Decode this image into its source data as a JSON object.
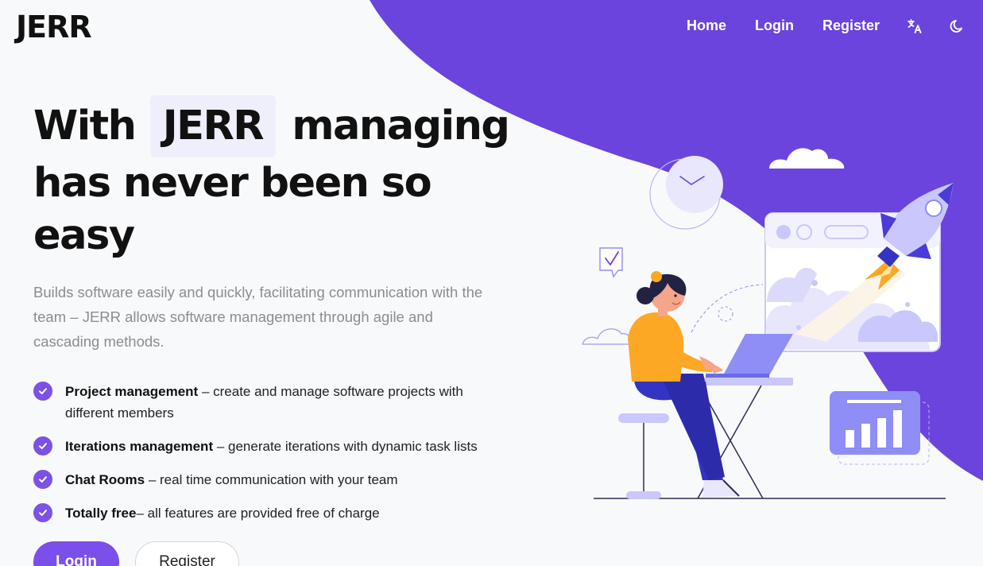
{
  "header": {
    "logo": "JERR",
    "nav": {
      "home": "Home",
      "login": "Login",
      "register": "Register"
    },
    "icons": [
      "translate-icon",
      "moon-icon"
    ]
  },
  "hero": {
    "headline_before": "With",
    "headline_highlight": "JERR",
    "headline_after": "managing",
    "headline_line2": "has never been so easy",
    "subtitle": "Builds software easily and quickly, facilitating communication with the team – JERR allows software management through agile and cascading methods."
  },
  "features": [
    {
      "title": "Project management",
      "text": " – create and manage software projects with different members"
    },
    {
      "title": "Iterations management",
      "text": " – generate iterations with dynamic task lists"
    },
    {
      "title": "Chat Rooms",
      "text": " – real time communication with your team"
    },
    {
      "title": "Totally free",
      "text": "– all features are provided free of charge"
    }
  ],
  "actions": {
    "login": "Login",
    "register": "Register"
  },
  "colors": {
    "accent": "#6b44dd",
    "button": "#7b4fe9",
    "check": "#7b51e6",
    "background": "#f8f9fa",
    "illustration_light": "#c9c7fb",
    "illustration_mid": "#8f8df6",
    "shirt": "#fca824",
    "pants": "#3434c2"
  }
}
